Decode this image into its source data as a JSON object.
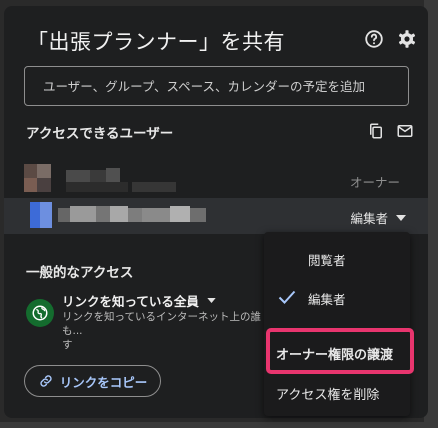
{
  "dialog": {
    "title": "「出張プランナー」を共有",
    "help_icon": "help-circle-icon",
    "settings_icon": "gear-icon"
  },
  "search": {
    "placeholder": "ユーザー、グループ、スペース、カレンダーの予定を追加"
  },
  "people_section": {
    "label": "アクセスできるユーザー",
    "copy_icon": "copy-icon",
    "email_icon": "mail-icon"
  },
  "people": [
    {
      "role": "オーナー"
    },
    {
      "role": "編集者",
      "dropdown_icon": "caret-down-icon"
    }
  ],
  "general_access": {
    "label": "一般的なアクセス",
    "icon": "globe-icon",
    "setting": "リンクを知っている全員",
    "description": "リンクを知っているインターネット上の誰も...",
    "description_end": "す"
  },
  "copy_link": {
    "label": "リンクをコピー",
    "icon": "link-icon"
  },
  "role_menu": {
    "items": [
      {
        "label": "閲覧者",
        "checked": false
      },
      {
        "label": "編集者",
        "checked": true
      },
      {
        "label": "オーナー権限の譲渡",
        "highlighted": true
      },
      {
        "label": "アクセス権を削除"
      }
    ]
  },
  "colors": {
    "dialog_bg": "#1e1f20",
    "accent_link": "#a8c7fa",
    "highlight_border": "#e8356e",
    "globe_bg": "#146c2e"
  }
}
